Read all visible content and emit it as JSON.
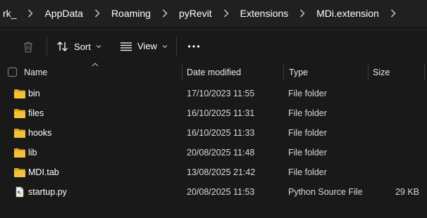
{
  "breadcrumb": [
    "rk_",
    "AppData",
    "Roaming",
    "pyRevit",
    "Extensions",
    "MDi.extension"
  ],
  "toolbar": {
    "delete_icon": "trash-icon",
    "sort_label": "Sort",
    "view_label": "View",
    "more_icon": "more-icon"
  },
  "columns": {
    "name": "Name",
    "date": "Date modified",
    "type": "Type",
    "size": "Size"
  },
  "files": [
    {
      "name": "bin",
      "date": "17/10/2023 11:55",
      "type": "File folder",
      "size": "",
      "icon": "folder-icon"
    },
    {
      "name": "files",
      "date": "16/10/2025 11:31",
      "type": "File folder",
      "size": "",
      "icon": "folder-icon"
    },
    {
      "name": "hooks",
      "date": "16/10/2025 11:33",
      "type": "File folder",
      "size": "",
      "icon": "folder-icon"
    },
    {
      "name": "lib",
      "date": "20/08/2025 11:48",
      "type": "File folder",
      "size": "",
      "icon": "folder-icon"
    },
    {
      "name": "MDI.tab",
      "date": "13/08/2025 21:42",
      "type": "File folder",
      "size": "",
      "icon": "folder-icon"
    },
    {
      "name": "startup.py",
      "date": "20/08/2025 11:53",
      "type": "Python Source File",
      "size": "29 KB",
      "icon": "python-file-icon"
    }
  ],
  "colors": {
    "background": "#191919",
    "folder": "#f3c23a",
    "folder_dark": "#d9a521"
  }
}
